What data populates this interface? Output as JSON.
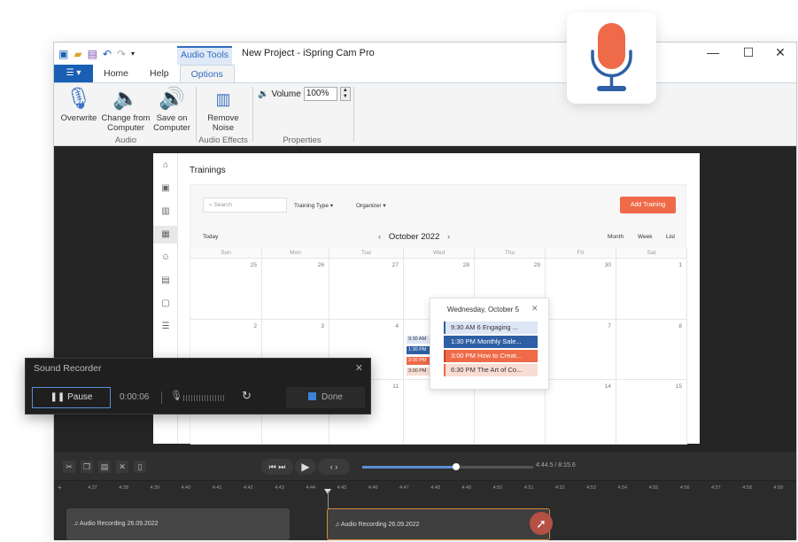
{
  "titlebar": {
    "context_tab": "Audio Tools",
    "title": "New Project - iSpring Cam Pro",
    "minimize": "—",
    "maximize": "☐",
    "close": "✕"
  },
  "tabs": [
    {
      "label": "Home",
      "active": false
    },
    {
      "label": "Help",
      "active": false
    },
    {
      "label": "Options",
      "active": true
    }
  ],
  "ribbon": {
    "overwrite": "Overwrite",
    "change_line1": "Change from",
    "change_line2": "Computer",
    "save_line1": "Save on",
    "save_line2": "Computer",
    "remove_line1": "Remove",
    "remove_line2": "Noise",
    "volume_label": "Volume",
    "volume_value": "100%",
    "group_audio": "Audio",
    "group_effects": "Audio Effects",
    "group_properties": "Properties"
  },
  "calendar": {
    "title": "Trainings",
    "search_placeholder": "Search",
    "training_type": "Training Type",
    "organizer": "Organizer",
    "add_button": "Add Training",
    "today": "Today",
    "month_label": "October 2022",
    "views": [
      "Month",
      "Week",
      "List"
    ],
    "weekdays": [
      "Sun",
      "Mon",
      "Tue",
      "Wed",
      "Thu",
      "Fri",
      "Sat"
    ],
    "row1": [
      "25",
      "26",
      "27",
      "28",
      "29",
      "30",
      "1"
    ],
    "row2": [
      "2",
      "3",
      "4",
      "",
      "",
      "7",
      "8"
    ],
    "row3": [
      "",
      "",
      "11",
      "",
      "",
      "14",
      "15"
    ],
    "mini_events": [
      "9:30 AM",
      "1:30 PM",
      "3:00 PM",
      "3:00 PM"
    ],
    "popup": {
      "header": "Wednesday, October 5",
      "close": "✕",
      "events": [
        {
          "text": "9:30 AM 6 Engaging ...",
          "color": "#dde6f5"
        },
        {
          "text": "1:30 PM Monthly Sale...",
          "color": "#2e5fa4"
        },
        {
          "text": "3:00 PM How to Creat...",
          "color": "#ee6a48"
        },
        {
          "text": "6:30 PM The Art of Co...",
          "color": "#f9dcd4"
        }
      ]
    }
  },
  "recorder": {
    "title": "Sound Recorder",
    "close": "✕",
    "pause_label": "Pause",
    "time": "0:00:06",
    "done_label": "Done"
  },
  "timeline": {
    "time_readout": "4:44.5 / 8:15.6",
    "ticks": [
      "4:37",
      "4:38",
      "4:39",
      "4:40",
      "4:41",
      "4:42",
      "4:43",
      "4:44",
      "4:45",
      "4:46",
      "4:47",
      "4:48",
      "4:49",
      "4:50",
      "4:51",
      "4:52",
      "4:53",
      "4:54",
      "4:55",
      "4:56",
      "4:57",
      "4:58",
      "4:59"
    ],
    "clip1": "Audio Recording 26.09.2022",
    "clip2": "Audio Recording 26.09.2022",
    "progress_fraction": 0.55
  },
  "colors": {
    "accent": "#2f6bbf",
    "add_button": "#ee6a48",
    "mic_red": "#ee6a48",
    "mic_blue": "#2e5fa4"
  }
}
